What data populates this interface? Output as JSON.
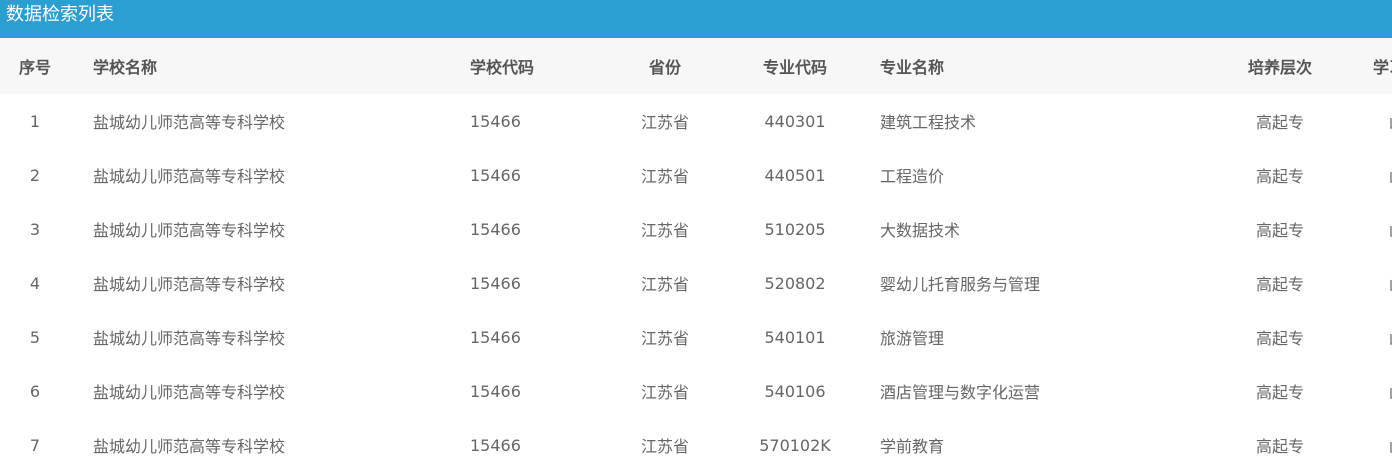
{
  "title": "数据检索列表",
  "columns": [
    "序号",
    "学校名称",
    "学校代码",
    "省份",
    "专业代码",
    "专业名称",
    "培养层次",
    "学习形式"
  ],
  "rows": [
    [
      "1",
      "盐城幼儿师范高等专科学校",
      "15466",
      "江苏省",
      "440301",
      "建筑工程技术",
      "高起专",
      "函授"
    ],
    [
      "2",
      "盐城幼儿师范高等专科学校",
      "15466",
      "江苏省",
      "440501",
      "工程造价",
      "高起专",
      "函授"
    ],
    [
      "3",
      "盐城幼儿师范高等专科学校",
      "15466",
      "江苏省",
      "510205",
      "大数据技术",
      "高起专",
      "函授"
    ],
    [
      "4",
      "盐城幼儿师范高等专科学校",
      "15466",
      "江苏省",
      "520802",
      "婴幼儿托育服务与管理",
      "高起专",
      "函授"
    ],
    [
      "5",
      "盐城幼儿师范高等专科学校",
      "15466",
      "江苏省",
      "540101",
      "旅游管理",
      "高起专",
      "函授"
    ],
    [
      "6",
      "盐城幼儿师范高等专科学校",
      "15466",
      "江苏省",
      "540106",
      "酒店管理与数字化运营",
      "高起专",
      "函授"
    ],
    [
      "7",
      "盐城幼儿师范高等专科学校",
      "15466",
      "江苏省",
      "570102K",
      "学前教育",
      "高起专",
      "函授"
    ]
  ],
  "colors": {
    "title_bar": "#2b9fd1",
    "header_bg": "#f7f7f7"
  }
}
